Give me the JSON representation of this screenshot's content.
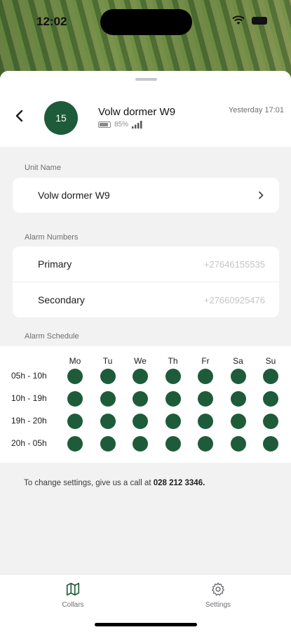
{
  "status_bar": {
    "time": "12:02"
  },
  "header": {
    "avatar_number": "15",
    "unit_name": "Volw dormer W9",
    "battery": "85%",
    "battery_level": 0.85,
    "last_seen": "Yesterday 17:01"
  },
  "unit_section": {
    "label": "Unit Name",
    "value": "Volw dormer W9"
  },
  "alarm_numbers": {
    "label": "Alarm Numbers",
    "rows": [
      {
        "label": "Primary",
        "value": "+27646155535"
      },
      {
        "label": "Secondary",
        "value": "+27660925476"
      }
    ]
  },
  "alarm_schedule": {
    "label": "Alarm Schedule",
    "days": [
      "Mo",
      "Tu",
      "We",
      "Th",
      "Fr",
      "Sa",
      "Su"
    ],
    "slots": [
      "05h - 10h",
      "10h - 19h",
      "19h - 20h",
      "20h - 05h"
    ]
  },
  "footer_note": {
    "text": "To change settings, give us a call at ",
    "phone": "028 212 3346."
  },
  "tabs": [
    {
      "label": "Collars",
      "icon": "map-icon"
    },
    {
      "label": "Settings",
      "icon": "gear-icon"
    }
  ],
  "colors": {
    "accent": "#1e5b3a",
    "background": "#f2f2f2"
  }
}
